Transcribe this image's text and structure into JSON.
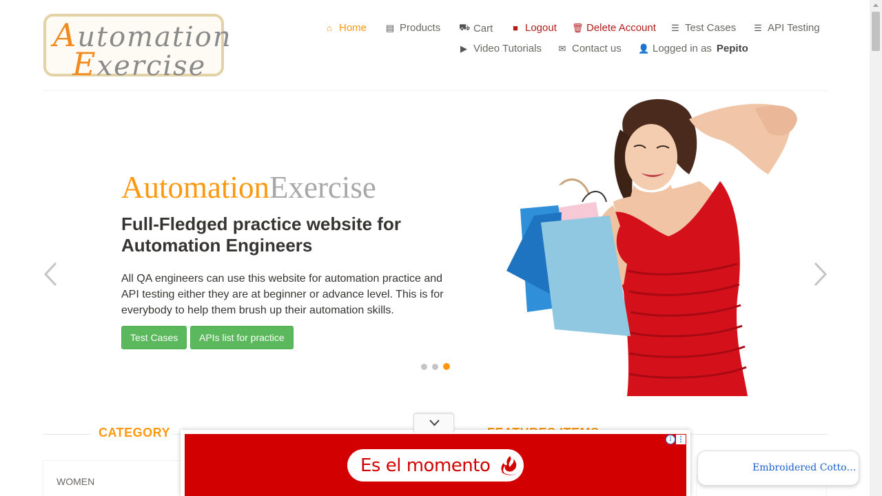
{
  "logo": {
    "line1_cap": "A",
    "line1_rest": "utomation",
    "line2_cap": "E",
    "line2_rest": "xercise"
  },
  "nav": {
    "home": "Home",
    "products": "Products",
    "cart": "Cart",
    "logout": "Logout",
    "delete_account": "Delete Account",
    "test_cases": "Test Cases",
    "api_testing": "API Testing",
    "video_tutorials": "Video Tutorials",
    "contact_us": "Contact us",
    "logged_in_as": "Logged in as",
    "username": "Pepito"
  },
  "slider": {
    "title_part1": "Automation",
    "title_part2": "Exercise",
    "subtitle": "Full-Fledged practice website for Automation Engineers",
    "description": "All QA engineers can use this website for automation practice and API testing either they are at beginner or advance level. This is for everybody to help them brush up their automation skills.",
    "btn_test_cases": "Test Cases",
    "btn_apis": "APIs list for practice",
    "active_slide": 3,
    "slide_count": 3,
    "prev_arrow": "‹",
    "next_arrow": "›"
  },
  "sidebar": {
    "title": "CATEGORY",
    "items": [
      "WOMEN"
    ]
  },
  "features": {
    "title": "FEATURES ITEMS"
  },
  "ad": {
    "text": "Es el momento",
    "info_icon": "i",
    "menu_icon": "⋮"
  },
  "floating_chip": {
    "text": "Embroidered Cotto…"
  },
  "colors": {
    "accent": "#fe980f",
    "button_green": "#5cb85c",
    "danger": "#b31b1b",
    "ad_red": "#d20000"
  }
}
